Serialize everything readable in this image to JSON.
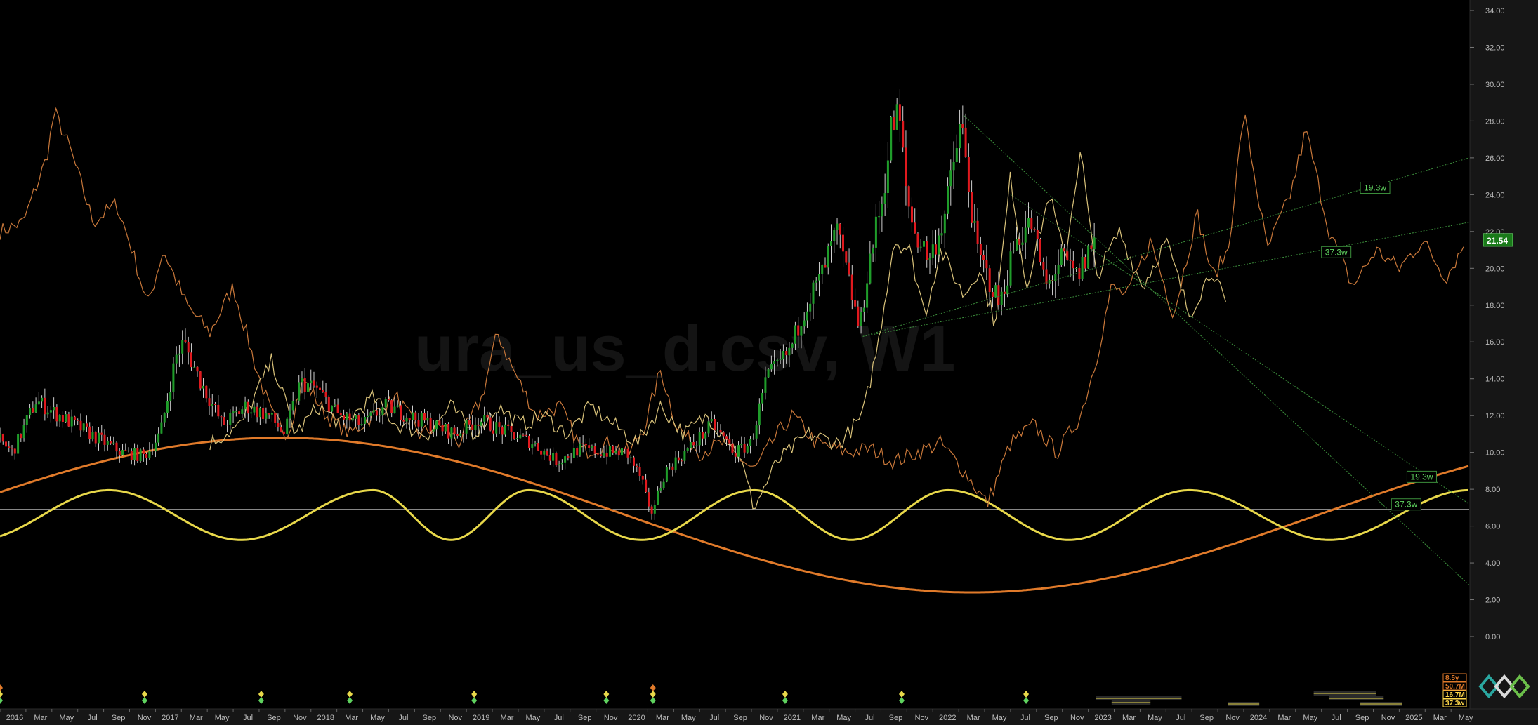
{
  "chart_data": {
    "type": "line",
    "title": "ura_us_d.csv, W1",
    "last_price": "21.54",
    "y_ticks": [
      "34.00",
      "32.00",
      "30.00",
      "28.00",
      "26.00",
      "24.00",
      "22.00",
      "20.00",
      "18.00",
      "16.00",
      "14.00",
      "12.00",
      "10.00",
      "8.00",
      "6.00",
      "4.00",
      "2.00",
      "0.00"
    ],
    "ylim": [
      0,
      34
    ],
    "x_ticks": [
      "2016",
      "Mar",
      "May",
      "Jul",
      "Sep",
      "Nov",
      "2017",
      "Mar",
      "May",
      "Jul",
      "Sep",
      "Nov",
      "2018",
      "Mar",
      "May",
      "Jul",
      "Sep",
      "Nov",
      "2019",
      "Mar",
      "May",
      "Jul",
      "Sep",
      "Nov",
      "2020",
      "Mar",
      "May",
      "Jul",
      "Sep",
      "Nov",
      "2021",
      "Mar",
      "May",
      "Jul",
      "Sep",
      "Nov",
      "2022",
      "Mar",
      "May",
      "Jul",
      "Sep",
      "Nov",
      "2023",
      "Mar",
      "May",
      "Jul",
      "Sep",
      "Nov",
      "2024",
      "Mar",
      "May",
      "Jul",
      "Sep",
      "Nov",
      "2025",
      "Mar",
      "May"
    ],
    "xlim": [
      2016.0,
      2025.45
    ],
    "horizontal_line": 6.9,
    "price_anchors": [
      [
        2016.0,
        10.8
      ],
      [
        2016.1,
        10.0
      ],
      [
        2016.25,
        12.8
      ],
      [
        2016.4,
        12.0
      ],
      [
        2016.6,
        11.0
      ],
      [
        2016.8,
        10.0
      ],
      [
        2016.95,
        9.8
      ],
      [
        2017.05,
        11.0
      ],
      [
        2017.15,
        15.2
      ],
      [
        2017.2,
        16.0
      ],
      [
        2017.3,
        14.0
      ],
      [
        2017.45,
        11.5
      ],
      [
        2017.6,
        12.5
      ],
      [
        2017.75,
        12.0
      ],
      [
        2017.85,
        11.0
      ],
      [
        2017.95,
        13.8
      ],
      [
        2018.05,
        13.5
      ],
      [
        2018.2,
        12.0
      ],
      [
        2018.35,
        11.5
      ],
      [
        2018.5,
        12.5
      ],
      [
        2018.65,
        12.0
      ],
      [
        2018.8,
        11.5
      ],
      [
        2018.95,
        11.0
      ],
      [
        2019.1,
        11.8
      ],
      [
        2019.25,
        11.2
      ],
      [
        2019.45,
        10.5
      ],
      [
        2019.6,
        9.5
      ],
      [
        2019.75,
        10.2
      ],
      [
        2019.9,
        10.0
      ],
      [
        2020.05,
        10.0
      ],
      [
        2020.15,
        8.5
      ],
      [
        2020.2,
        6.5
      ],
      [
        2020.3,
        9.0
      ],
      [
        2020.45,
        10.2
      ],
      [
        2020.6,
        11.5
      ],
      [
        2020.75,
        10.0
      ],
      [
        2020.85,
        10.5
      ],
      [
        2020.95,
        14.0
      ],
      [
        2021.0,
        14.5
      ],
      [
        2021.1,
        15.5
      ],
      [
        2021.2,
        18.0
      ],
      [
        2021.3,
        19.5
      ],
      [
        2021.4,
        22.0
      ],
      [
        2021.5,
        18.5
      ],
      [
        2021.55,
        16.5
      ],
      [
        2021.6,
        20.0
      ],
      [
        2021.7,
        24.0
      ],
      [
        2021.75,
        27.5
      ],
      [
        2021.8,
        28.5
      ],
      [
        2021.85,
        24.0
      ],
      [
        2021.9,
        22.0
      ],
      [
        2022.0,
        20.5
      ],
      [
        2022.1,
        23.0
      ],
      [
        2022.2,
        28.0
      ],
      [
        2022.3,
        21.0
      ],
      [
        2022.35,
        20.0
      ],
      [
        2022.45,
        18.0
      ],
      [
        2022.55,
        21.5
      ],
      [
        2022.65,
        22.5
      ],
      [
        2022.75,
        19.0
      ],
      [
        2022.85,
        20.5
      ],
      [
        2022.95,
        19.5
      ],
      [
        2023.05,
        21.5
      ]
    ],
    "overlay_orange": [
      [
        2016.0,
        22.0
      ],
      [
        2016.15,
        22.5
      ],
      [
        2016.3,
        26.0
      ],
      [
        2016.35,
        28.5
      ],
      [
        2016.45,
        26.5
      ],
      [
        2016.6,
        22.5
      ],
      [
        2016.75,
        23.5
      ],
      [
        2016.85,
        21.0
      ],
      [
        2016.95,
        18.0
      ],
      [
        2017.05,
        21.0
      ],
      [
        2017.2,
        18.0
      ],
      [
        2017.35,
        16.5
      ],
      [
        2017.5,
        19.0
      ],
      [
        2017.65,
        14.5
      ],
      [
        2017.75,
        12.0
      ],
      [
        2017.85,
        11.0
      ],
      [
        2017.95,
        14.0
      ],
      [
        2018.1,
        12.0
      ],
      [
        2018.25,
        11.0
      ],
      [
        2018.4,
        12.0
      ],
      [
        2018.55,
        13.0
      ],
      [
        2018.7,
        11.0
      ],
      [
        2018.85,
        11.5
      ],
      [
        2018.95,
        10.5
      ],
      [
        2019.1,
        13.0
      ],
      [
        2019.2,
        16.5
      ],
      [
        2019.3,
        14.5
      ],
      [
        2019.45,
        12.0
      ],
      [
        2019.6,
        12.5
      ],
      [
        2019.75,
        10.0
      ],
      [
        2019.9,
        10.5
      ],
      [
        2020.05,
        10.0
      ],
      [
        2020.15,
        11.5
      ],
      [
        2020.25,
        14.5
      ],
      [
        2020.35,
        11.5
      ],
      [
        2020.5,
        10.0
      ],
      [
        2020.65,
        10.5
      ],
      [
        2020.85,
        9.0
      ],
      [
        2021.0,
        11.0
      ],
      [
        2021.1,
        12.0
      ],
      [
        2021.25,
        10.5
      ],
      [
        2021.45,
        10.0
      ],
      [
        2021.6,
        10.2
      ],
      [
        2021.75,
        9.5
      ],
      [
        2021.9,
        10.0
      ],
      [
        2022.05,
        10.5
      ],
      [
        2022.2,
        9.0
      ],
      [
        2022.35,
        7.2
      ],
      [
        2022.5,
        10.5
      ],
      [
        2022.65,
        11.5
      ],
      [
        2022.8,
        10.0
      ],
      [
        2022.95,
        12.0
      ],
      [
        2023.05,
        15.0
      ],
      [
        2023.15,
        19.0
      ],
      [
        2023.25,
        18.5
      ],
      [
        2023.4,
        21.5
      ],
      [
        2023.55,
        17.5
      ],
      [
        2023.7,
        23.0
      ],
      [
        2023.8,
        19.5
      ],
      [
        2023.9,
        21.0
      ],
      [
        2024.0,
        28.5
      ],
      [
        2024.15,
        21.0
      ],
      [
        2024.3,
        24.0
      ],
      [
        2024.4,
        27.5
      ],
      [
        2024.55,
        22.0
      ],
      [
        2024.7,
        19.0
      ],
      [
        2024.85,
        21.0
      ],
      [
        2025.0,
        20.0
      ],
      [
        2025.15,
        21.5
      ],
      [
        2025.3,
        19.5
      ],
      [
        2025.42,
        21.3
      ]
    ],
    "overlay_yellow": [
      [
        2017.35,
        10.5
      ],
      [
        2017.55,
        11.5
      ],
      [
        2017.75,
        15.0
      ],
      [
        2017.9,
        11.0
      ],
      [
        2018.05,
        12.5
      ],
      [
        2018.2,
        11.5
      ],
      [
        2018.4,
        13.0
      ],
      [
        2018.55,
        11.5
      ],
      [
        2018.75,
        11.0
      ],
      [
        2018.9,
        12.5
      ],
      [
        2019.05,
        11.0
      ],
      [
        2019.2,
        12.5
      ],
      [
        2019.35,
        11.5
      ],
      [
        2019.5,
        12.0
      ],
      [
        2019.65,
        11.0
      ],
      [
        2019.8,
        12.5
      ],
      [
        2019.95,
        11.5
      ],
      [
        2020.1,
        10.5
      ],
      [
        2020.25,
        12.5
      ],
      [
        2020.4,
        11.0
      ],
      [
        2020.55,
        12.0
      ],
      [
        2020.75,
        10.0
      ],
      [
        2020.85,
        7.0
      ],
      [
        2021.0,
        9.5
      ],
      [
        2021.2,
        11.0
      ],
      [
        2021.4,
        10.5
      ],
      [
        2021.55,
        12.0
      ],
      [
        2021.65,
        16.0
      ],
      [
        2021.75,
        21.5
      ],
      [
        2021.85,
        21.0
      ],
      [
        2021.95,
        17.5
      ],
      [
        2022.05,
        21.0
      ],
      [
        2022.2,
        18.5
      ],
      [
        2022.3,
        20.0
      ],
      [
        2022.4,
        17.0
      ],
      [
        2022.5,
        25.0
      ],
      [
        2022.6,
        19.0
      ],
      [
        2022.75,
        24.0
      ],
      [
        2022.85,
        20.5
      ],
      [
        2022.95,
        26.5
      ],
      [
        2023.05,
        19.5
      ],
      [
        2023.2,
        22.0
      ],
      [
        2023.35,
        19.0
      ],
      [
        2023.5,
        21.5
      ],
      [
        2023.65,
        17.5
      ],
      [
        2023.8,
        20.0
      ],
      [
        2023.9,
        17.5
      ]
    ],
    "cycle_long": {
      "label": "",
      "amplitude": 4.2,
      "mid": 6.6,
      "peak_years": [
        2017.8,
        2022.25
      ],
      "period_years": 8.9
    },
    "cycle_short": {
      "label": "37.3w",
      "amplitude": 1.35,
      "mid": 6.6,
      "peak_years": [
        2016.7,
        2018.4,
        2019.4,
        2020.85,
        2022.1,
        2023.65,
        2025.45
      ]
    },
    "trendlines": [
      {
        "label": "19.3w",
        "from": [
          2021.55,
          16.3
        ],
        "to": [
          2025.45,
          26.0
        ],
        "color": "#3c8f3c"
      },
      {
        "label": "37.3w",
        "from": [
          2021.55,
          16.3
        ],
        "to": [
          2025.45,
          22.5
        ],
        "color": "#3c8f3c"
      },
      {
        "label": "19.3w",
        "from": [
          2022.2,
          28.3
        ],
        "to": [
          2025.45,
          2.8
        ],
        "color": "#3c8f3c"
      },
      {
        "label": "37.3w",
        "from": [
          2022.5,
          24.0
        ],
        "to": [
          2025.45,
          7.2
        ],
        "color": "#3c8f3c"
      }
    ],
    "trend_labels": [
      {
        "text": "19.3w",
        "x": 2024.75,
        "y": 24.3
      },
      {
        "text": "37.3w",
        "x": 2024.5,
        "y": 20.8
      },
      {
        "text": "19.3w",
        "x": 2025.05,
        "y": 8.6
      },
      {
        "text": "37.3w",
        "x": 2024.95,
        "y": 7.1
      }
    ],
    "legend": [
      {
        "text": "8.5y",
        "color": "#e07a2a"
      },
      {
        "text": "50.7M",
        "color": "#e07a2a"
      },
      {
        "text": "16.7M",
        "color": "#ffd84a"
      },
      {
        "text": "37.3w",
        "color": "#ffd84a"
      }
    ]
  },
  "colors": {
    "background": "#000000",
    "up_candle": "#1f9d2a",
    "down_candle": "#e0191e",
    "orange": "#e07a2a",
    "yellow": "#e8d84a",
    "pale_yellow": "#d9c27a",
    "trend": "#3c8f3c",
    "price_tag": "#1a7a1a"
  }
}
